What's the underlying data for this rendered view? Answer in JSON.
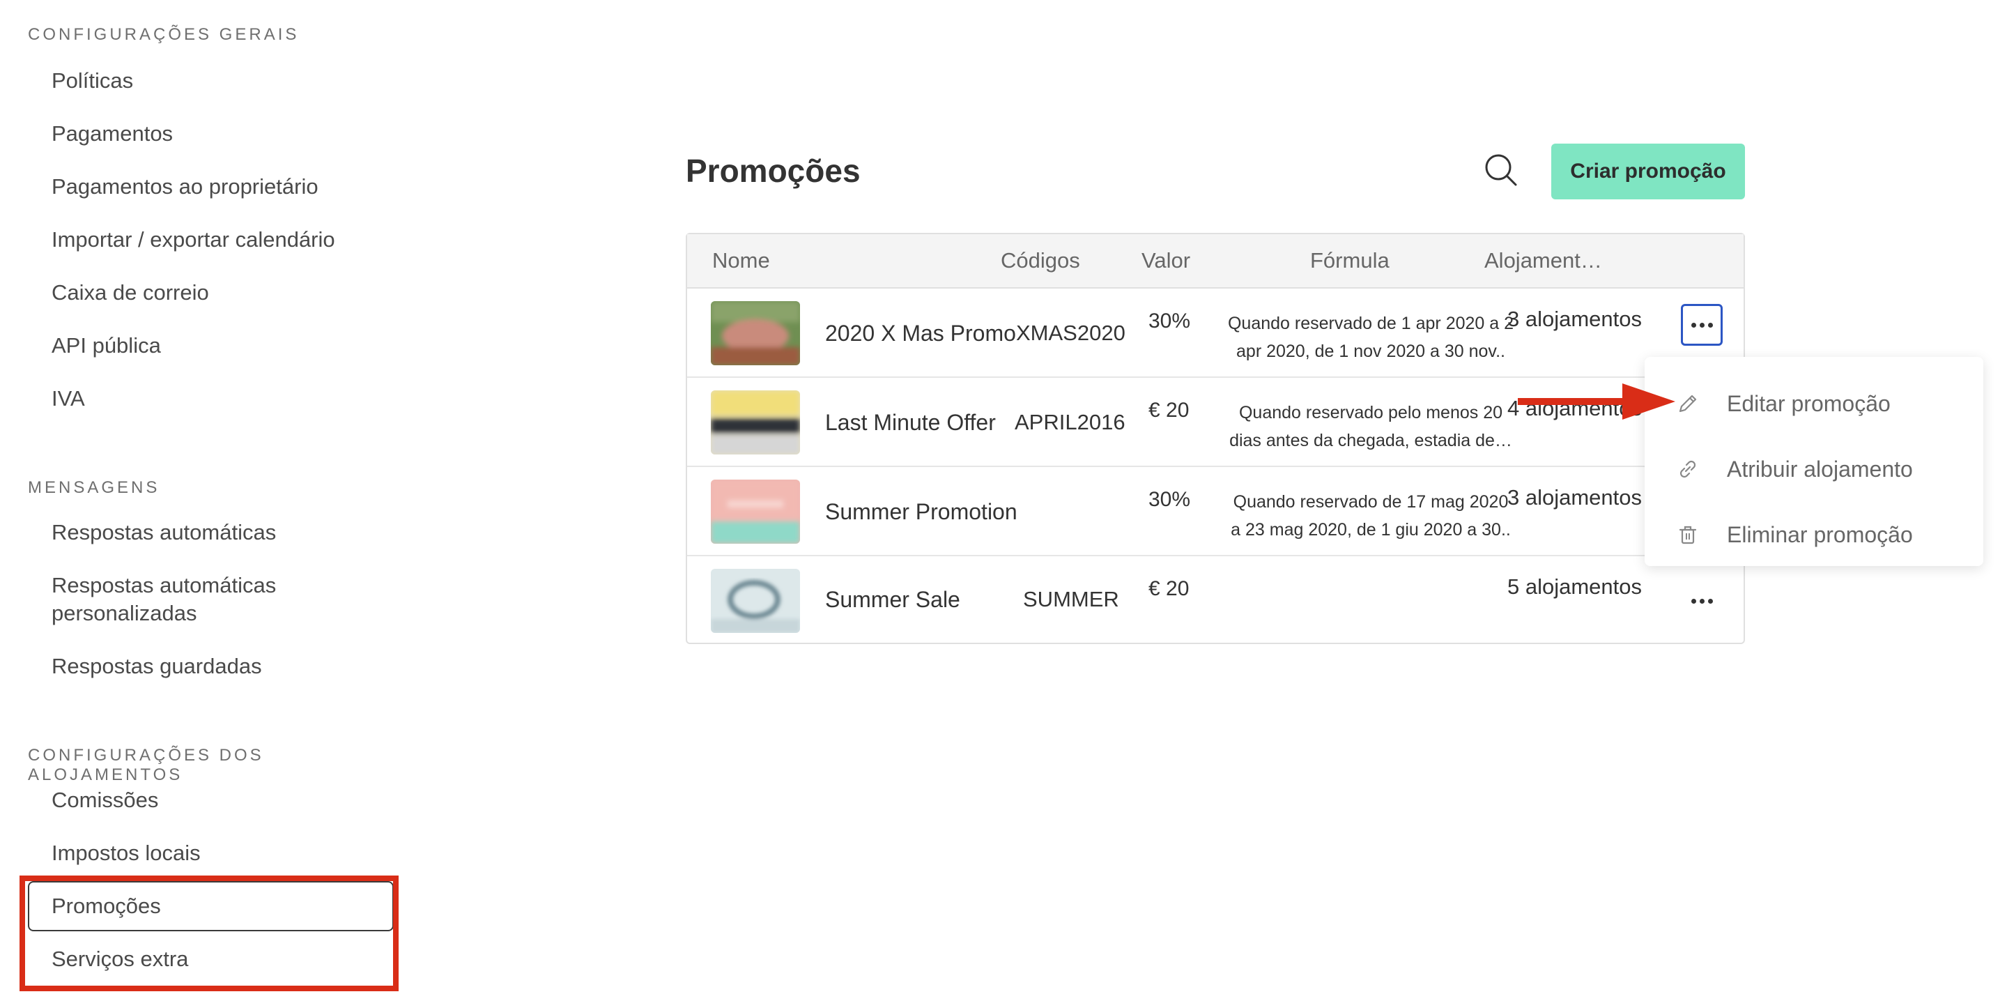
{
  "sidebar": {
    "sections": [
      {
        "title": "CONFIGURAÇÕES GERAIS",
        "items": [
          "Políticas",
          "Pagamentos",
          "Pagamentos ao proprietário",
          "Importar / exportar calendário",
          "Caixa de correio",
          "API pública",
          "IVA"
        ]
      },
      {
        "title": "MENSAGENS",
        "items": [
          "Respostas automáticas",
          "Respostas automáticas personalizadas",
          "Respostas guardadas"
        ]
      },
      {
        "title": "CONFIGURAÇÕES DOS ALOJAMENTOS",
        "items": [
          "Comissões",
          "Impostos locais",
          "Promoções",
          "Serviços extra"
        ]
      }
    ],
    "active_item": "Promoções"
  },
  "header": {
    "title": "Promoções",
    "search_icon": "search-icon",
    "create_label": "Criar promoção",
    "create_color": "#7fe5c2"
  },
  "table": {
    "columns": [
      "Nome",
      "Códigos",
      "Valor",
      "Fórmula",
      "Alojament…"
    ],
    "rows": [
      {
        "name": "2020 X Mas Promo",
        "code": "XMAS2020",
        "value": "30%",
        "formula_line1": "Quando reservado de 1 apr 2020 a 2",
        "formula_line2": "apr 2020, de 1 nov 2020 a 30 nov..",
        "alojamentos": "3 alojamentos"
      },
      {
        "name": "Last Minute Offer",
        "code": "APRIL2016",
        "value": "€ 20",
        "formula_line1": "Quando reservado pelo menos 20",
        "formula_line2": "dias antes da chegada, estadia de…",
        "alojamentos": "4 alojamentos"
      },
      {
        "name": "Summer Promotion",
        "code": "",
        "value": "30%",
        "formula_line1": "Quando reservado de 17 mag 2020",
        "formula_line2": "a 23 mag 2020, de 1 giu 2020 a 30..",
        "alojamentos": "3 alojamentos"
      },
      {
        "name": "Summer Sale",
        "code": "SUMMER",
        "value": "€ 20",
        "formula_line1": "",
        "formula_line2": "",
        "alojamentos": "5 alojamentos"
      }
    ]
  },
  "menu": {
    "items": [
      {
        "label": "Editar promoção",
        "icon": "pencil-icon"
      },
      {
        "label": "Atribuir alojamento",
        "icon": "link-icon"
      },
      {
        "label": "Eliminar promoção",
        "icon": "trash-icon"
      }
    ]
  },
  "annotations": {
    "highlight_color": "#d92d17",
    "focus_color": "#2c56c4"
  }
}
